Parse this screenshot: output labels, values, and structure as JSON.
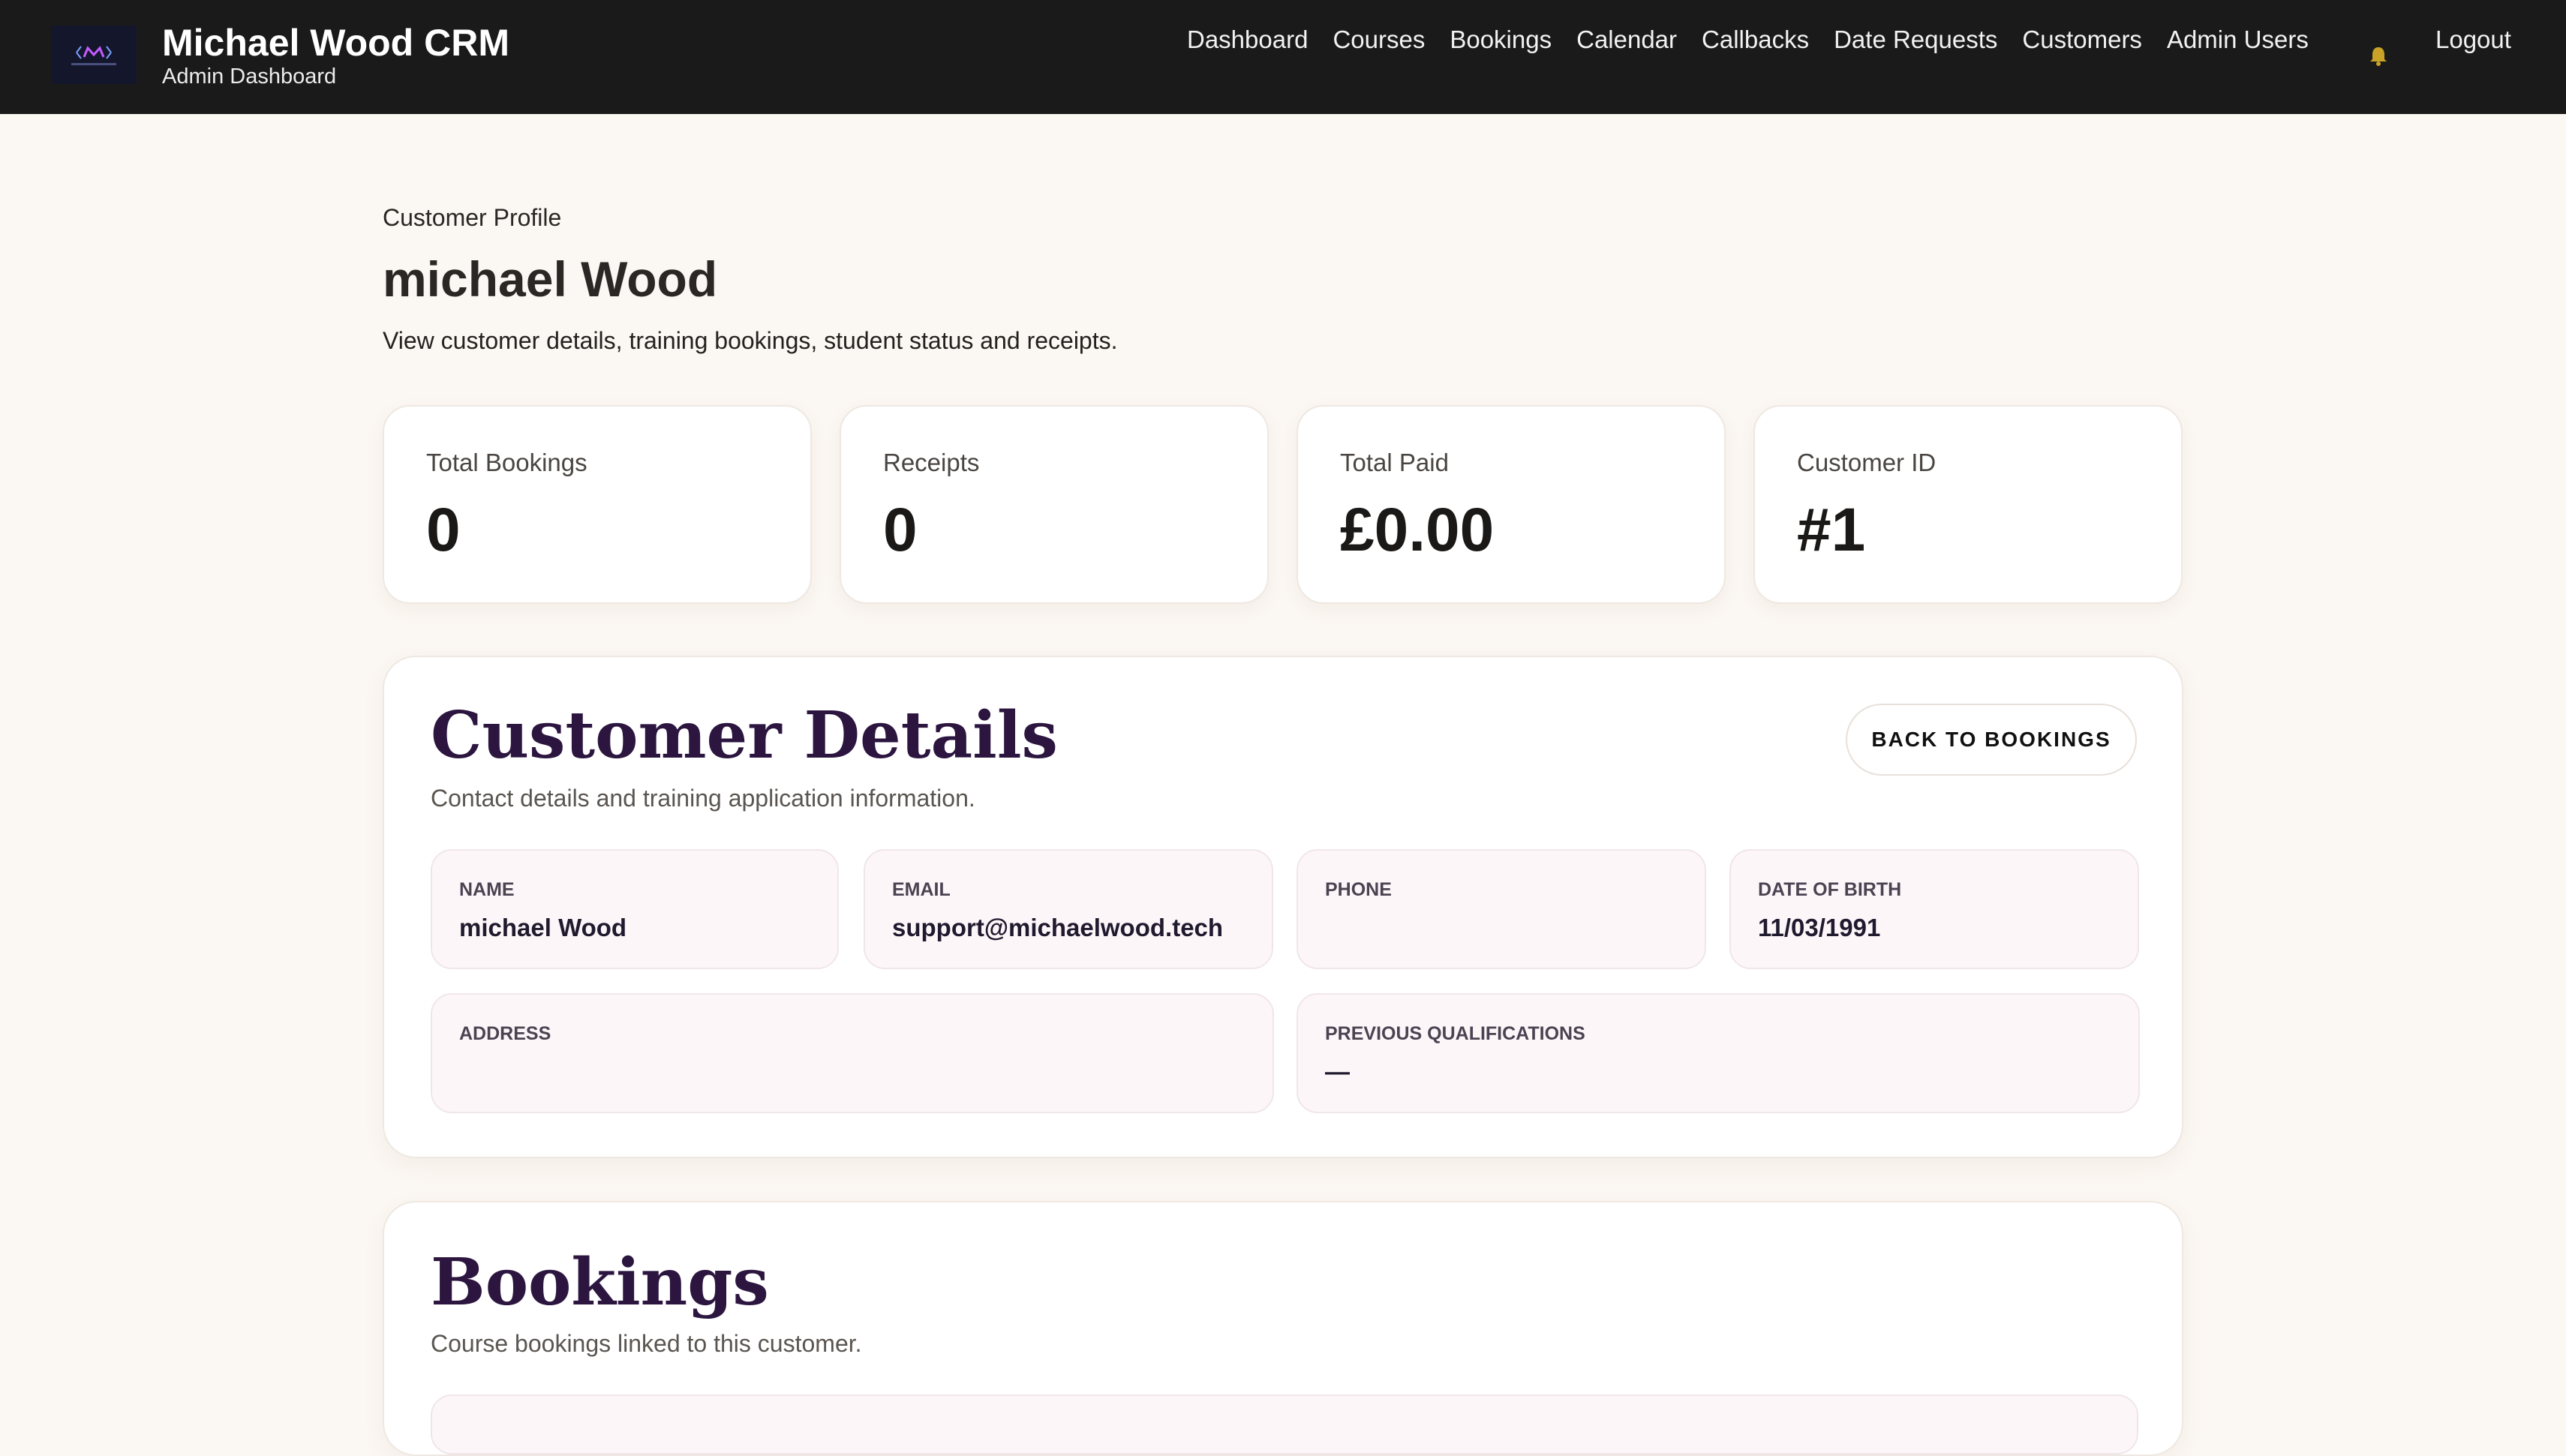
{
  "header": {
    "brand_title": "Michael Wood CRM",
    "brand_subtitle": "Admin Dashboard",
    "logo_icon": "mw-logo",
    "nav": [
      {
        "label": "Dashboard"
      },
      {
        "label": "Courses"
      },
      {
        "label": "Bookings"
      },
      {
        "label": "Calendar"
      },
      {
        "label": "Callbacks"
      },
      {
        "label": "Date Requests"
      },
      {
        "label": "Customers"
      },
      {
        "label": "Admin Users"
      }
    ],
    "notification_icon": "bell-icon",
    "logout_label": "Logout"
  },
  "page": {
    "eyebrow": "Customer Profile",
    "title": "michael Wood",
    "description": "View customer details, training bookings, student status and receipts."
  },
  "stats": [
    {
      "label": "Total Bookings",
      "value": "0"
    },
    {
      "label": "Receipts",
      "value": "0"
    },
    {
      "label": "Total Paid",
      "value": "£0.00"
    },
    {
      "label": "Customer ID",
      "value": "#1"
    }
  ],
  "details": {
    "title": "Customer Details",
    "description": "Contact details and training application information.",
    "back_button": "BACK TO BOOKINGS",
    "fields": {
      "name": {
        "label": "Name",
        "value": "michael Wood"
      },
      "email": {
        "label": "Email",
        "value": "support@michaelwood.tech"
      },
      "phone": {
        "label": "Phone",
        "value": ""
      },
      "dob": {
        "label": "Date of Birth",
        "value": "11/03/1991"
      },
      "address": {
        "label": "Address",
        "value": ""
      },
      "qualifications": {
        "label": "Previous Qualifications",
        "value": "—"
      }
    }
  },
  "bookings": {
    "title": "Bookings",
    "description": "Course bookings linked to this customer."
  },
  "colors": {
    "topbar": "#1a1a1a",
    "page_bg": "#fbf7f2",
    "panel_title": "#2c1640",
    "field_bg": "#fdf6f9"
  }
}
